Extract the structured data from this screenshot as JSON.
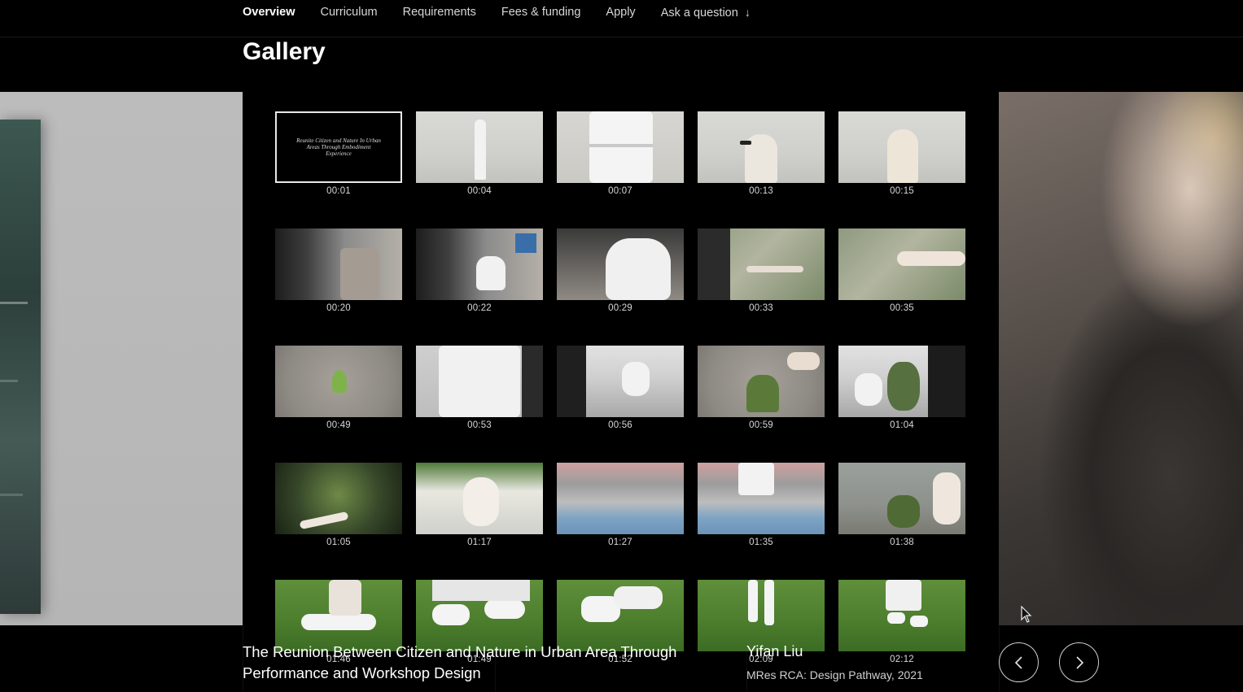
{
  "nav": {
    "items": [
      {
        "label": "Overview",
        "active": true
      },
      {
        "label": "Curriculum",
        "active": false
      },
      {
        "label": "Requirements",
        "active": false
      },
      {
        "label": "Fees & funding",
        "active": false
      },
      {
        "label": "Apply",
        "active": false
      },
      {
        "label": "Ask a question",
        "active": false
      }
    ],
    "ask_icon": "arrow-down-icon"
  },
  "gallery": {
    "title": "Gallery",
    "title_card_text": "Reunite Citizen and Nature In Urban Areas Through Embodiment Experience",
    "frames": [
      {
        "time": "00:01"
      },
      {
        "time": "00:04"
      },
      {
        "time": "00:07"
      },
      {
        "time": "00:13"
      },
      {
        "time": "00:15"
      },
      {
        "time": "00:20"
      },
      {
        "time": "00:22"
      },
      {
        "time": "00:29"
      },
      {
        "time": "00:33"
      },
      {
        "time": "00:35"
      },
      {
        "time": "00:49"
      },
      {
        "time": "00:53"
      },
      {
        "time": "00:56"
      },
      {
        "time": "00:59"
      },
      {
        "time": "01:04"
      },
      {
        "time": "01:05"
      },
      {
        "time": "01:17"
      },
      {
        "time": "01:27"
      },
      {
        "time": "01:35"
      },
      {
        "time": "01:38"
      },
      {
        "time": "01:46"
      },
      {
        "time": "01:49"
      },
      {
        "time": "01:52"
      },
      {
        "time": "02:09"
      },
      {
        "time": "02:12"
      }
    ]
  },
  "caption": {
    "title": "The Reunion Between Citizen and Nature in Urban Area Through Performance and Workshop Design",
    "author": "Yifan Liu",
    "programme": "MRes RCA: Design Pathway, 2021"
  },
  "controls": {
    "prev_icon": "chevron-left-icon",
    "next_icon": "chevron-right-icon"
  }
}
